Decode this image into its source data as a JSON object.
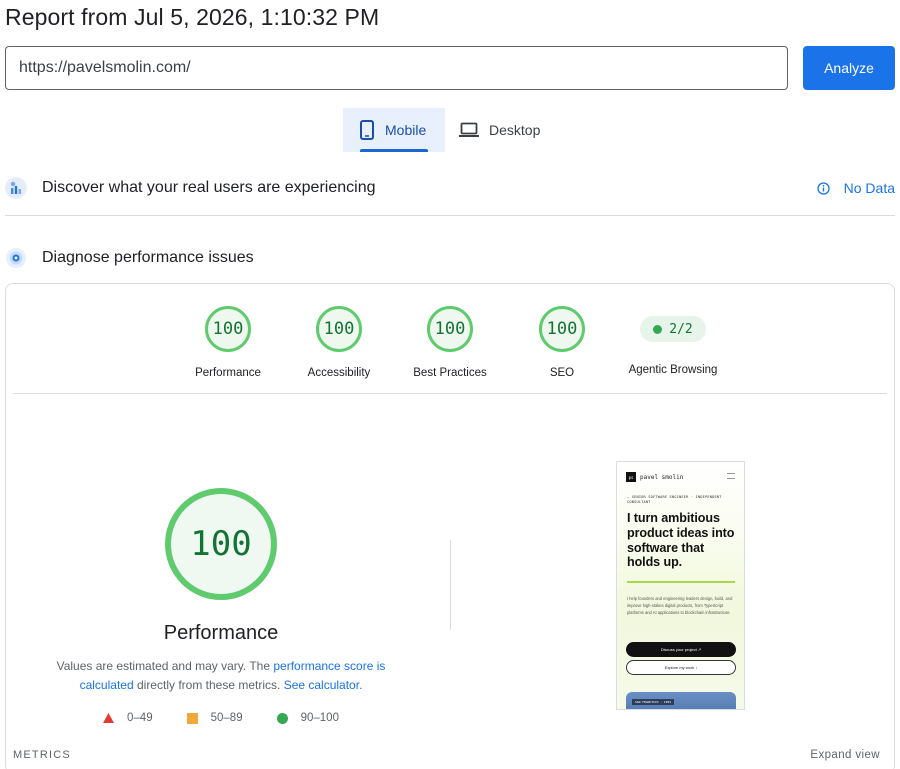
{
  "report": {
    "title": "Report from Jul 5, 2026, 1:10:32 PM"
  },
  "search": {
    "url": "https://pavelsmolin.com/",
    "analyze_label": "Analyze"
  },
  "device_tabs": {
    "mobile": "Mobile",
    "desktop": "Desktop",
    "selected": "Mobile"
  },
  "crux": {
    "title": "Discover what your real users are experiencing",
    "status": "No Data"
  },
  "diagnose": {
    "title": "Diagnose performance issues"
  },
  "gauges": [
    {
      "label": "Performance",
      "score": "100"
    },
    {
      "label": "Accessibility",
      "score": "100"
    },
    {
      "label": "Best Practices",
      "score": "100"
    },
    {
      "label": "SEO",
      "score": "100"
    }
  ],
  "agentic": {
    "label": "Agentic Browsing",
    "value": "2/2"
  },
  "performance": {
    "score": "100",
    "title": "Performance",
    "desc_prefix": "Values are estimated and may vary. The ",
    "desc_link_1": "performance score is calculated",
    "desc_mid": " directly from these metrics. ",
    "desc_link_2": "See calculator.",
    "legend": [
      {
        "range": "0–49",
        "icon": "red-triangle-icon"
      },
      {
        "range": "50–89",
        "icon": "orange-square-icon"
      },
      {
        "range": "90–100",
        "icon": "green-circle-icon"
      }
    ]
  },
  "metrics": {
    "label": "METRICS",
    "expand_label": "Expand view"
  },
  "screenshot": {
    "brand": "pavel smolin",
    "tagline": "— SENIOR SOFTWARE ENGINEER · INDEPENDENT CONSULTANT",
    "headline": "I turn ambitious product ideas into software that holds up.",
    "body": "I help founders and engineering leaders design, build, and improve high-stakes digital products, from TypeScript platforms and AI applications to blockchain infrastructure.",
    "cta_primary": "Discuss your project ↗",
    "cta_secondary": "Explore my work ↓",
    "location_tag": "SAN FRANCISCO · IRIS"
  },
  "colors": {
    "accent": "#1a73e8",
    "pass": "#5fcb6e",
    "pass_text": "#137333",
    "fail": "#e53935",
    "average": "#f0a83a"
  }
}
